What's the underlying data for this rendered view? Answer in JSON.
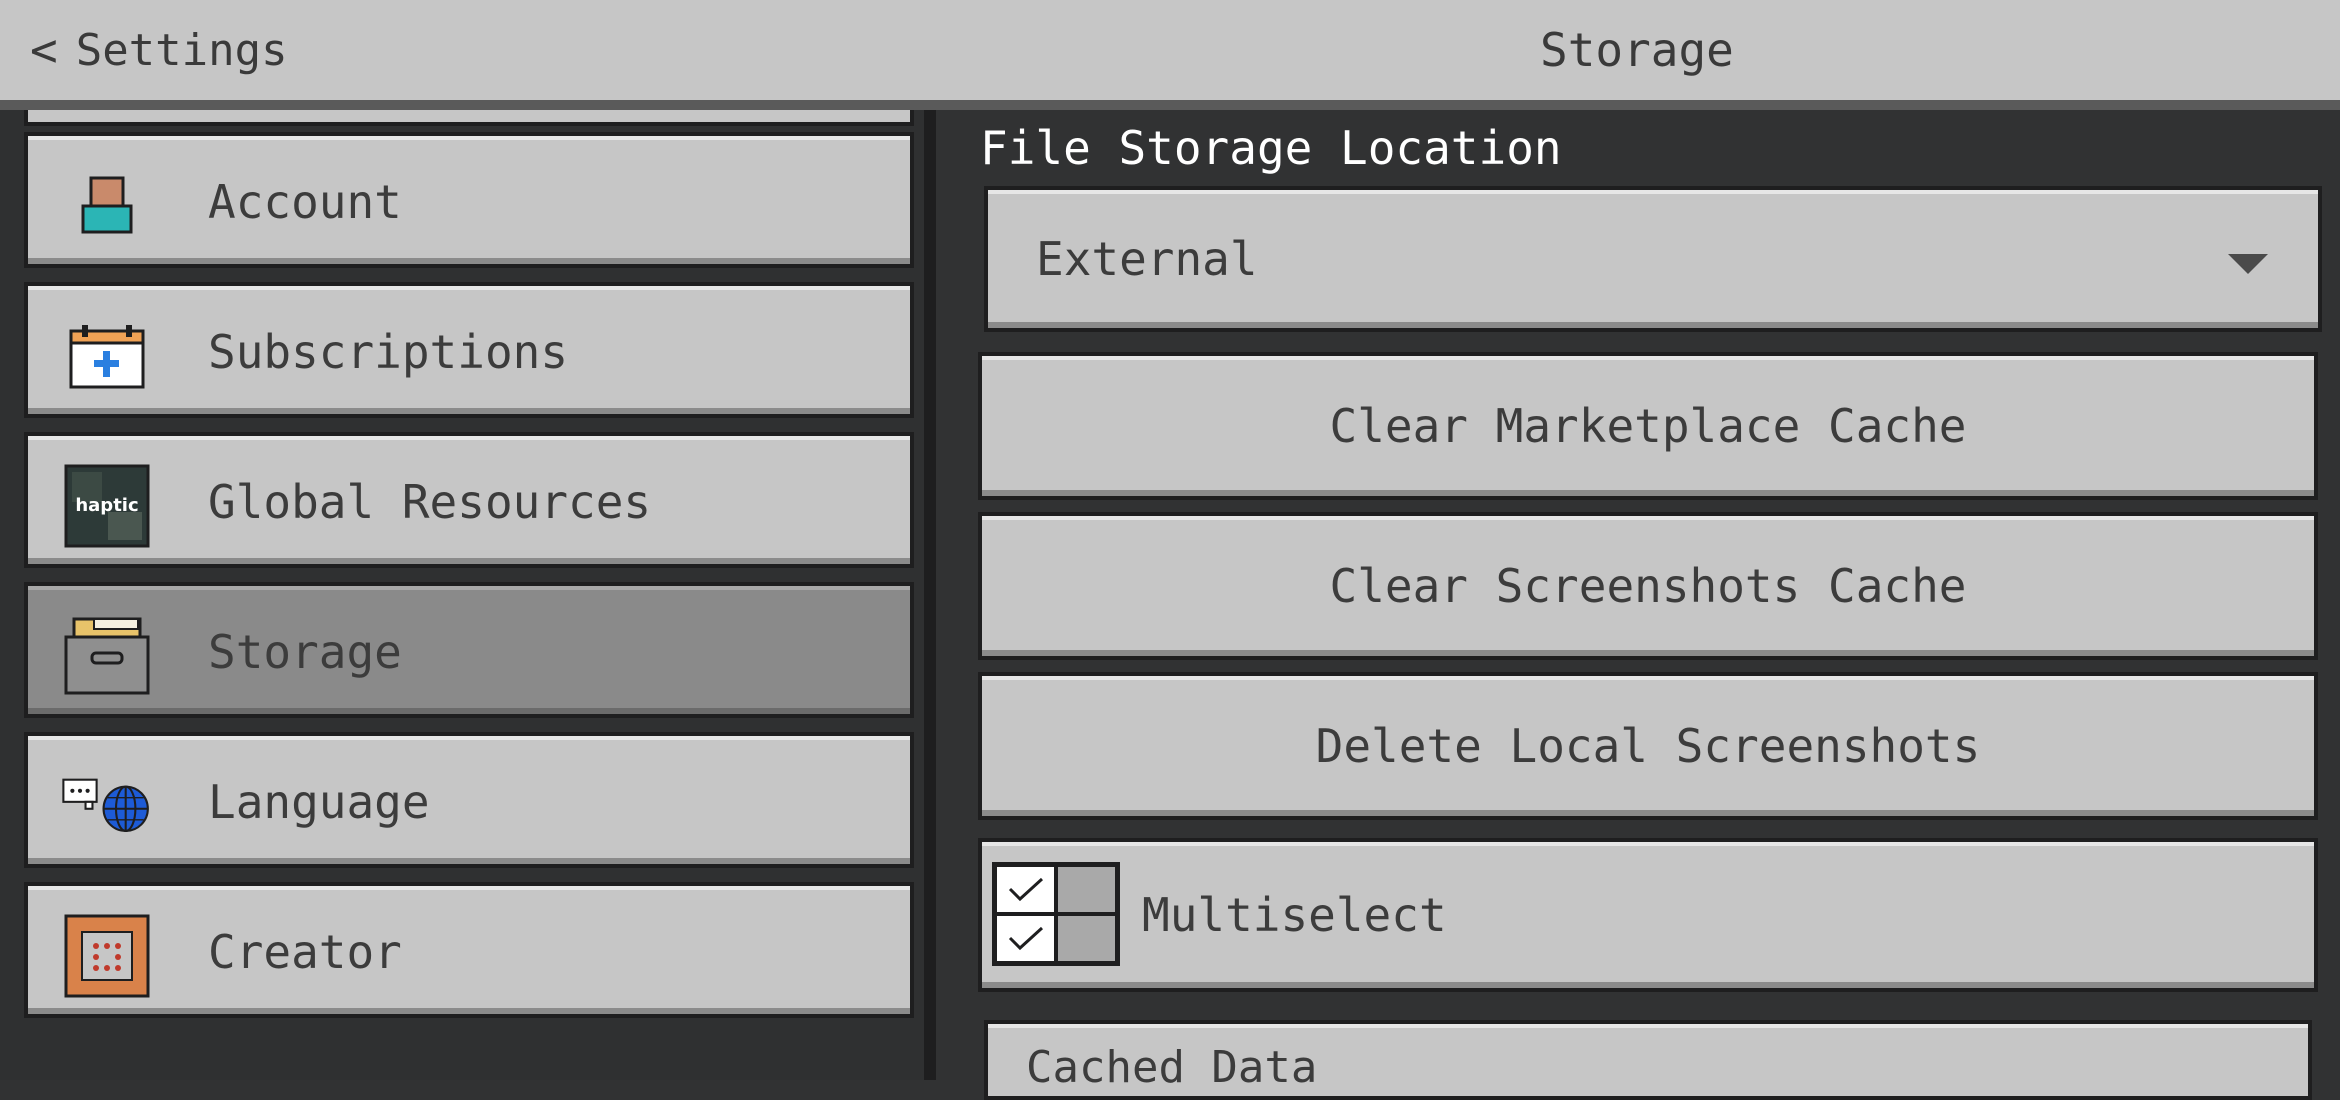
{
  "header": {
    "back_label": "Settings",
    "title": "Storage"
  },
  "nav": {
    "items": [
      {
        "label": "Account",
        "icon": "account-icon"
      },
      {
        "label": "Subscriptions",
        "icon": "calendar-plus-icon"
      },
      {
        "label": "Global Resources",
        "icon": "resource-pack-icon",
        "icon_text": "haptic"
      },
      {
        "label": "Storage",
        "icon": "storage-box-icon",
        "selected": true
      },
      {
        "label": "Language",
        "icon": "language-globe-icon"
      },
      {
        "label": "Creator",
        "icon": "command-block-icon"
      }
    ]
  },
  "main": {
    "section_label": "File Storage Location",
    "storage_location": {
      "value": "External",
      "icon": "chevron-down-icon"
    },
    "buttons": {
      "clear_marketplace": "Clear Marketplace Cache",
      "clear_screenshots": "Clear Screenshots Cache",
      "delete_local_screenshots": "Delete Local Screenshots"
    },
    "multiselect_label": "Multiselect",
    "cached_data_label": "Cached Data"
  },
  "colors": {
    "panel": "#c6c6c6",
    "selected": "#8a8a8a",
    "background": "#313233",
    "text": "#3c3c3c"
  }
}
